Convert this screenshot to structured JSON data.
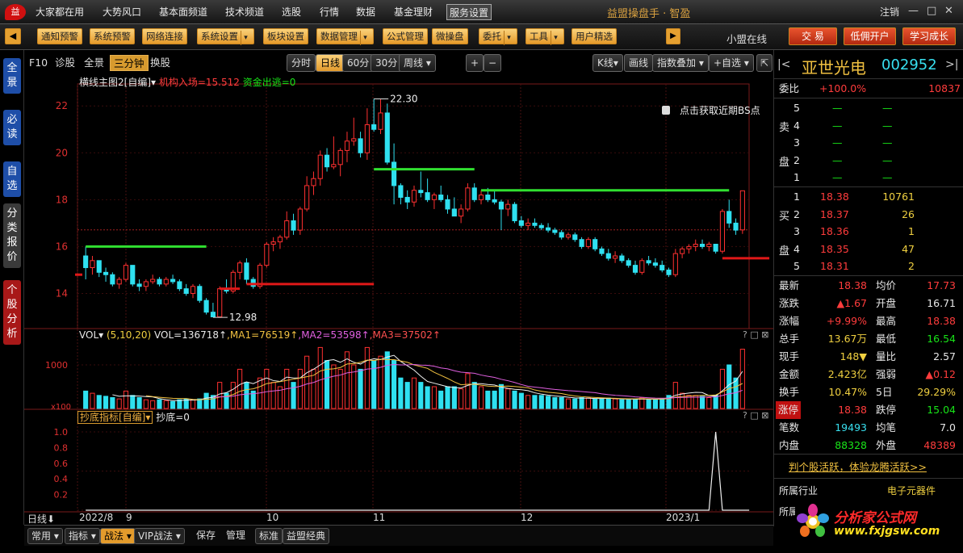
{
  "topbar": {
    "logo_text": "益",
    "menus": [
      "大家都在用",
      "大势风口",
      "基本面频道",
      "技术频道",
      "选股",
      "行情",
      "数据",
      "基金理财",
      "服务设置"
    ],
    "active_menu": "服务设置",
    "app_title": "益盟操盘手 · 智盈",
    "user_label": "注销"
  },
  "toolbar": {
    "buttons": [
      {
        "label": "通知预警",
        "dd": false
      },
      {
        "label": "系统预警",
        "dd": false
      },
      {
        "label": "网络连接",
        "dd": false
      },
      {
        "label": "系统设置",
        "dd": true
      },
      {
        "label": "板块设置",
        "dd": false
      },
      {
        "label": "数据管理",
        "dd": true
      },
      {
        "label": "公式管理",
        "dd": false
      },
      {
        "label": "微操盘",
        "dd": false
      },
      {
        "label": "委托",
        "dd": true
      },
      {
        "label": "工具",
        "dd": true
      },
      {
        "label": "用户精选",
        "dd": false
      }
    ],
    "arrow_button": "▶",
    "online_label": "小盟在线",
    "trade_button": "交 易",
    "commission_button": "低佣开户",
    "learn_button": "学习成长"
  },
  "leftbar": {
    "tabs": [
      "全景",
      "必读",
      "自选",
      "分类报价",
      "个股分析"
    ]
  },
  "period_tabs": {
    "items": [
      "F10",
      "诊股",
      "全景",
      "三分钟",
      "换股"
    ],
    "active": "三分钟"
  },
  "period_buttons": {
    "items": [
      "分时",
      "日线",
      "60分",
      "30分",
      "周线"
    ],
    "active": "日线",
    "zoom_in": "+",
    "zoom_out": "−"
  },
  "chart_tools": {
    "kline": "K线",
    "draw": "画线",
    "indicator_overlay": "指数叠加",
    "add_watch": "+自选"
  },
  "main_panel": {
    "header_name": "横线主图2[自编]",
    "jigou": "机构入场=15.512",
    "zijin": "资金出逃=0",
    "bs_hint": "点击获取近期BS点",
    "max_label": "22.30",
    "min_label": "12.98"
  },
  "vol_panel": {
    "name": "VOL",
    "params": "(5,10,20)",
    "vol": "VOL=136718↑",
    "ma1": "MA1=76519↑",
    "ma2": "MA2=53598↑",
    "ma3": "MA3=37502↑",
    "unit": "x100",
    "tick": "1000"
  },
  "chaodi_panel": {
    "name": "抄底指标[自编]",
    "value": "抄底=0"
  },
  "date_axis": {
    "period": "日线",
    "labels": [
      "2022/8",
      "9",
      "10",
      "11",
      "12",
      "2023/1"
    ]
  },
  "bottombar": {
    "buttons": [
      "常用",
      "指标",
      "战法",
      "VIP战法",
      "保存",
      "管理",
      "标准",
      "益盟经典"
    ],
    "active": "战法"
  },
  "stock": {
    "name": "亚世光电",
    "code": "002952",
    "weibi_label": "委比",
    "weibi": "+100.0%",
    "weicha": "10837",
    "sell_label": [
      "卖",
      "盘"
    ],
    "buy_label": [
      "买",
      "盘"
    ],
    "sell": [
      {
        "lvl": "5",
        "price": "—",
        "vol": "—"
      },
      {
        "lvl": "4",
        "price": "—",
        "vol": "—"
      },
      {
        "lvl": "3",
        "price": "—",
        "vol": "—"
      },
      {
        "lvl": "2",
        "price": "—",
        "vol": "—"
      },
      {
        "lvl": "1",
        "price": "—",
        "vol": "—"
      }
    ],
    "buy": [
      {
        "lvl": "1",
        "price": "18.38",
        "vol": "10761"
      },
      {
        "lvl": "2",
        "price": "18.37",
        "vol": "26"
      },
      {
        "lvl": "3",
        "price": "18.36",
        "vol": "1"
      },
      {
        "lvl": "4",
        "price": "18.35",
        "vol": "47"
      },
      {
        "lvl": "5",
        "price": "18.31",
        "vol": "2"
      }
    ],
    "stats": [
      {
        "l1": "最新",
        "v1": "18.38",
        "c1": "r",
        "l2": "均价",
        "v2": "17.73",
        "c2": "r"
      },
      {
        "l1": "涨跌",
        "v1": "▲1.67",
        "c1": "r",
        "l2": "开盘",
        "v2": "16.71",
        "c2": "w"
      },
      {
        "l1": "涨幅",
        "v1": "+9.99%",
        "c1": "r",
        "l2": "最高",
        "v2": "18.38",
        "c2": "r"
      },
      {
        "l1": "总手",
        "v1": "13.67万",
        "c1": "y",
        "l2": "最低",
        "v2": "16.54",
        "c2": "g"
      },
      {
        "l1": "现手",
        "v1": "148▼",
        "c1": "y",
        "l2": "量比",
        "v2": "2.57",
        "c2": "w"
      },
      {
        "l1": "金额",
        "v1": "2.423亿",
        "c1": "y",
        "l2": "强弱",
        "v2": "▲0.12",
        "c2": "r"
      },
      {
        "l1": "换手",
        "v1": "10.47%",
        "c1": "y",
        "l2": "5日",
        "v2": "29.29%",
        "c2": "y"
      },
      {
        "l1": "涨停",
        "v1": "18.38",
        "c1": "r",
        "l2": "跌停",
        "v2": "15.04",
        "c2": "g"
      },
      {
        "l1": "笔数",
        "v1": "19493",
        "c1": "c",
        "l2": "均笔",
        "v2": "7.0",
        "c2": "w"
      },
      {
        "l1": "内盘",
        "v1": "88328",
        "c1": "g",
        "l2": "外盘",
        "v2": "48389",
        "c2": "r"
      }
    ],
    "promo": "判个股活跃，体验龙腾活跃>>",
    "industry_label": "所属行业",
    "industry": "电子元器件",
    "region_label": "所属",
    "watermark": "分析家公式网",
    "watermark_url": "www.fxjgsw.com"
  },
  "chart_data": {
    "type": "candlestick",
    "ylim": [
      12.5,
      22.8
    ],
    "yticks": [
      14,
      16,
      18,
      20,
      22
    ],
    "candles": [
      [
        15.6,
        16.0,
        14.6,
        15.1,
        0.4
      ],
      [
        15.1,
        15.6,
        14.8,
        15.4,
        0.35
      ],
      [
        15.4,
        15.4,
        14.7,
        14.9,
        0.3
      ],
      [
        14.9,
        15.1,
        14.5,
        14.8,
        0.28
      ],
      [
        14.8,
        14.9,
        14.3,
        14.4,
        0.25
      ],
      [
        14.4,
        14.7,
        14.2,
        14.6,
        0.22
      ],
      [
        14.6,
        15.3,
        14.5,
        15.2,
        0.4
      ],
      [
        15.2,
        15.2,
        14.3,
        14.4,
        0.3
      ],
      [
        14.4,
        14.6,
        14.1,
        14.3,
        0.25
      ],
      [
        14.3,
        14.6,
        14.1,
        14.5,
        0.2
      ],
      [
        14.5,
        14.8,
        14.4,
        14.6,
        0.18
      ],
      [
        14.6,
        14.7,
        14.3,
        14.4,
        0.2
      ],
      [
        14.4,
        14.7,
        14.3,
        14.6,
        0.18
      ],
      [
        14.6,
        14.8,
        14.4,
        14.5,
        0.16
      ],
      [
        14.5,
        14.6,
        14.1,
        14.2,
        0.2
      ],
      [
        14.2,
        14.4,
        13.9,
        14.0,
        0.22
      ],
      [
        14.0,
        14.4,
        13.8,
        14.3,
        0.2
      ],
      [
        14.3,
        14.4,
        13.6,
        13.7,
        0.22
      ],
      [
        13.7,
        13.8,
        13.1,
        13.2,
        0.35
      ],
      [
        13.2,
        13.6,
        12.98,
        13.0,
        0.3
      ],
      [
        13.0,
        14.3,
        12.98,
        14.2,
        0.6
      ],
      [
        14.2,
        14.6,
        14.0,
        14.1,
        0.35
      ],
      [
        14.1,
        15.0,
        14.0,
        14.9,
        0.6
      ],
      [
        14.9,
        15.4,
        14.6,
        15.3,
        0.9
      ],
      [
        15.3,
        15.5,
        14.4,
        14.6,
        0.6
      ],
      [
        14.6,
        14.7,
        14.2,
        14.3,
        0.4
      ],
      [
        14.3,
        15.3,
        14.2,
        15.2,
        0.7
      ],
      [
        15.2,
        16.2,
        15.1,
        16.1,
        0.9
      ],
      [
        16.1,
        16.4,
        15.8,
        16.2,
        0.6
      ],
      [
        16.2,
        16.5,
        15.9,
        16.4,
        0.5
      ],
      [
        16.4,
        17.5,
        16.3,
        17.1,
        0.9
      ],
      [
        17.1,
        17.4,
        16.5,
        16.7,
        0.6
      ],
      [
        16.7,
        17.7,
        16.5,
        17.6,
        0.9
      ],
      [
        17.6,
        19.0,
        17.5,
        18.6,
        1.2
      ],
      [
        18.6,
        19.2,
        18.2,
        18.9,
        0.9
      ],
      [
        18.9,
        20.1,
        18.6,
        19.9,
        1.4
      ],
      [
        19.9,
        20.2,
        19.2,
        19.4,
        1.1
      ],
      [
        19.4,
        20.7,
        19.3,
        19.5,
        1.0
      ],
      [
        19.5,
        20.2,
        19.0,
        20.1,
        0.9
      ],
      [
        20.1,
        20.9,
        19.6,
        20.5,
        1.3
      ],
      [
        20.5,
        21.5,
        20.3,
        20.6,
        1.0
      ],
      [
        20.6,
        20.9,
        19.8,
        20.0,
        0.9
      ],
      [
        20.0,
        21.9,
        19.7,
        21.2,
        1.4
      ],
      [
        21.2,
        22.3,
        20.9,
        21.0,
        1.1
      ],
      [
        21.0,
        22.3,
        20.8,
        21.7,
        1.2
      ],
      [
        21.7,
        22.1,
        19.5,
        19.6,
        1.3
      ],
      [
        19.6,
        20.4,
        17.8,
        18.6,
        1.1
      ],
      [
        18.6,
        18.7,
        17.8,
        18.1,
        0.7
      ],
      [
        18.1,
        18.4,
        17.6,
        17.9,
        0.6
      ],
      [
        17.9,
        18.6,
        17.7,
        18.4,
        0.7
      ],
      [
        18.4,
        19.2,
        18.1,
        18.3,
        0.6
      ],
      [
        18.3,
        18.9,
        17.9,
        18.0,
        0.5
      ],
      [
        18.0,
        18.3,
        17.6,
        18.2,
        0.5
      ],
      [
        18.2,
        18.6,
        17.9,
        18.0,
        0.4
      ],
      [
        18.0,
        18.2,
        17.4,
        17.6,
        0.5
      ],
      [
        17.6,
        18.1,
        17.3,
        17.3,
        0.5
      ],
      [
        17.3,
        17.8,
        17.0,
        17.6,
        0.45
      ],
      [
        17.6,
        18.7,
        17.5,
        18.5,
        0.8
      ],
      [
        18.5,
        18.7,
        17.9,
        18.0,
        0.6
      ],
      [
        18.0,
        18.4,
        17.8,
        18.2,
        0.5
      ],
      [
        18.2,
        18.5,
        17.9,
        18.0,
        0.4
      ],
      [
        18.0,
        18.4,
        17.8,
        17.9,
        0.4
      ],
      [
        17.9,
        18.0,
        16.7,
        17.6,
        0.55
      ],
      [
        17.6,
        18.0,
        17.3,
        17.8,
        0.45
      ],
      [
        17.8,
        17.9,
        17.0,
        17.1,
        0.4
      ],
      [
        17.1,
        17.3,
        16.8,
        16.9,
        0.35
      ],
      [
        16.9,
        17.2,
        16.7,
        17.0,
        0.3
      ],
      [
        17.0,
        17.2,
        16.8,
        16.9,
        0.3
      ],
      [
        16.9,
        17.0,
        16.7,
        16.8,
        0.3
      ],
      [
        16.8,
        17.0,
        16.6,
        16.7,
        0.28
      ],
      [
        16.7,
        16.8,
        16.5,
        16.6,
        0.25
      ],
      [
        16.6,
        16.7,
        16.3,
        16.4,
        0.25
      ],
      [
        16.4,
        16.6,
        16.3,
        16.5,
        0.22
      ],
      [
        16.5,
        16.6,
        16.2,
        16.3,
        0.22
      ],
      [
        16.3,
        16.4,
        15.9,
        16.0,
        0.25
      ],
      [
        16.0,
        16.4,
        15.9,
        16.3,
        0.24
      ],
      [
        16.3,
        16.4,
        15.8,
        15.9,
        0.22
      ],
      [
        15.9,
        16.0,
        15.6,
        15.7,
        0.22
      ],
      [
        15.7,
        15.9,
        15.4,
        15.5,
        0.24
      ],
      [
        15.5,
        15.8,
        15.3,
        15.6,
        0.22
      ],
      [
        15.6,
        15.7,
        15.3,
        15.4,
        0.2
      ],
      [
        15.4,
        15.5,
        15.1,
        15.2,
        0.2
      ],
      [
        15.2,
        15.4,
        14.8,
        14.9,
        0.22
      ],
      [
        14.9,
        15.5,
        14.8,
        15.4,
        0.25
      ],
      [
        15.4,
        15.6,
        15.2,
        15.3,
        0.2
      ],
      [
        15.3,
        15.5,
        15.1,
        15.2,
        0.2
      ],
      [
        15.2,
        15.4,
        14.9,
        15.0,
        0.22
      ],
      [
        15.0,
        15.1,
        14.7,
        14.8,
        0.3
      ],
      [
        14.8,
        15.9,
        14.7,
        15.7,
        0.6
      ],
      [
        15.7,
        16.0,
        15.5,
        15.9,
        0.35
      ],
      [
        15.9,
        16.1,
        15.7,
        16.0,
        0.3
      ],
      [
        16.0,
        16.3,
        15.8,
        16.1,
        0.3
      ],
      [
        16.1,
        16.3,
        15.9,
        16.0,
        0.28
      ],
      [
        16.0,
        16.2,
        15.8,
        16.1,
        0.25
      ],
      [
        16.1,
        16.1,
        15.7,
        15.8,
        0.3
      ],
      [
        15.8,
        17.6,
        15.7,
        17.5,
        0.9
      ],
      [
        17.5,
        18.0,
        16.8,
        17.0,
        1.0
      ],
      [
        17.0,
        17.2,
        16.5,
        16.7,
        0.7
      ],
      [
        16.71,
        18.38,
        16.54,
        18.38,
        1.36
      ]
    ],
    "green_lines": [
      [
        0,
        18,
        16.0
      ],
      [
        43,
        58,
        19.3
      ],
      [
        59,
        96,
        18.4
      ]
    ],
    "red_lines": [
      [
        20,
        23,
        14.2
      ],
      [
        24,
        43,
        14.4
      ],
      [
        95,
        102,
        15.5
      ]
    ],
    "ref_price": 16.71,
    "vol_ylim": [
      0,
      1500
    ],
    "chaodi": [
      [
        0,
        0
      ],
      [
        93,
        0
      ],
      [
        94,
        1
      ],
      [
        95,
        0
      ],
      [
        99,
        0
      ]
    ]
  }
}
